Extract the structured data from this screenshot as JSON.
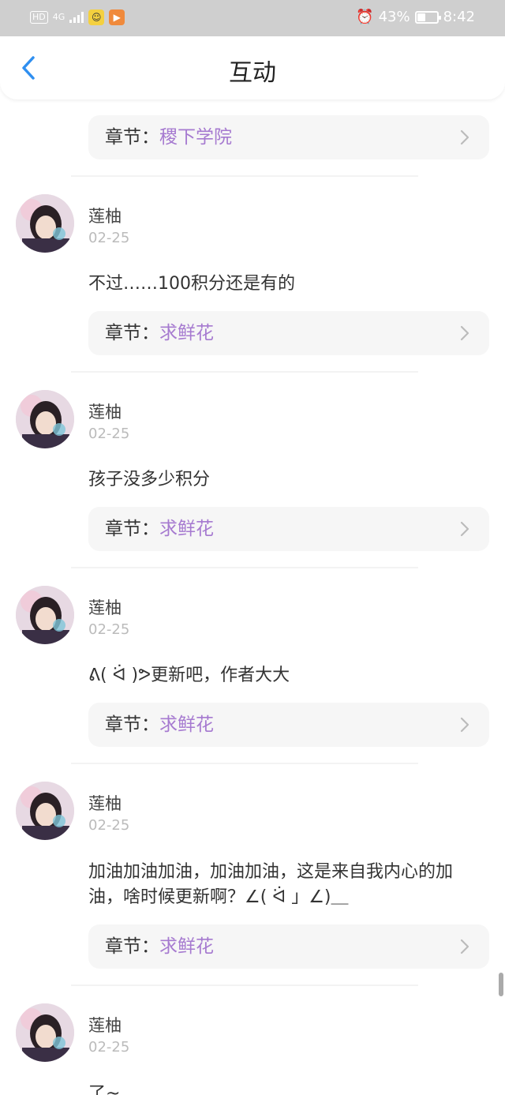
{
  "status_bar": {
    "hd": "HD",
    "network": "4G",
    "battery_text": "43%",
    "battery_level": 0.43,
    "time": "8:42"
  },
  "nav": {
    "title": "互动",
    "back_icon": "chevron-left-icon"
  },
  "chapter_label": "章节：",
  "top_chapter": {
    "name": "稷下学院"
  },
  "comments": [
    {
      "user": "莲柚",
      "date": "02-25",
      "content": "不过……100积分还是有的",
      "chapter": "求鲜花"
    },
    {
      "user": "莲柚",
      "date": "02-25",
      "content": "孩子没多少积分",
      "chapter": "求鲜花"
    },
    {
      "user": "莲柚",
      "date": "02-25",
      "content": "ᕕ( ᐛ )ᕗ更新吧，作者大大",
      "chapter": "求鲜花"
    },
    {
      "user": "莲柚",
      "date": "02-25",
      "content": "加油加油加油，加油加油，这是来自我内心的加油，啥时候更新啊？∠( ᐛ 」∠)＿",
      "chapter": "求鲜花"
    },
    {
      "user": "莲柚",
      "date": "02-25",
      "content": "了~",
      "chapter": ""
    }
  ],
  "colors": {
    "accent_blue": "#2f8ff0",
    "chapter_purple": "#a67ad0"
  }
}
